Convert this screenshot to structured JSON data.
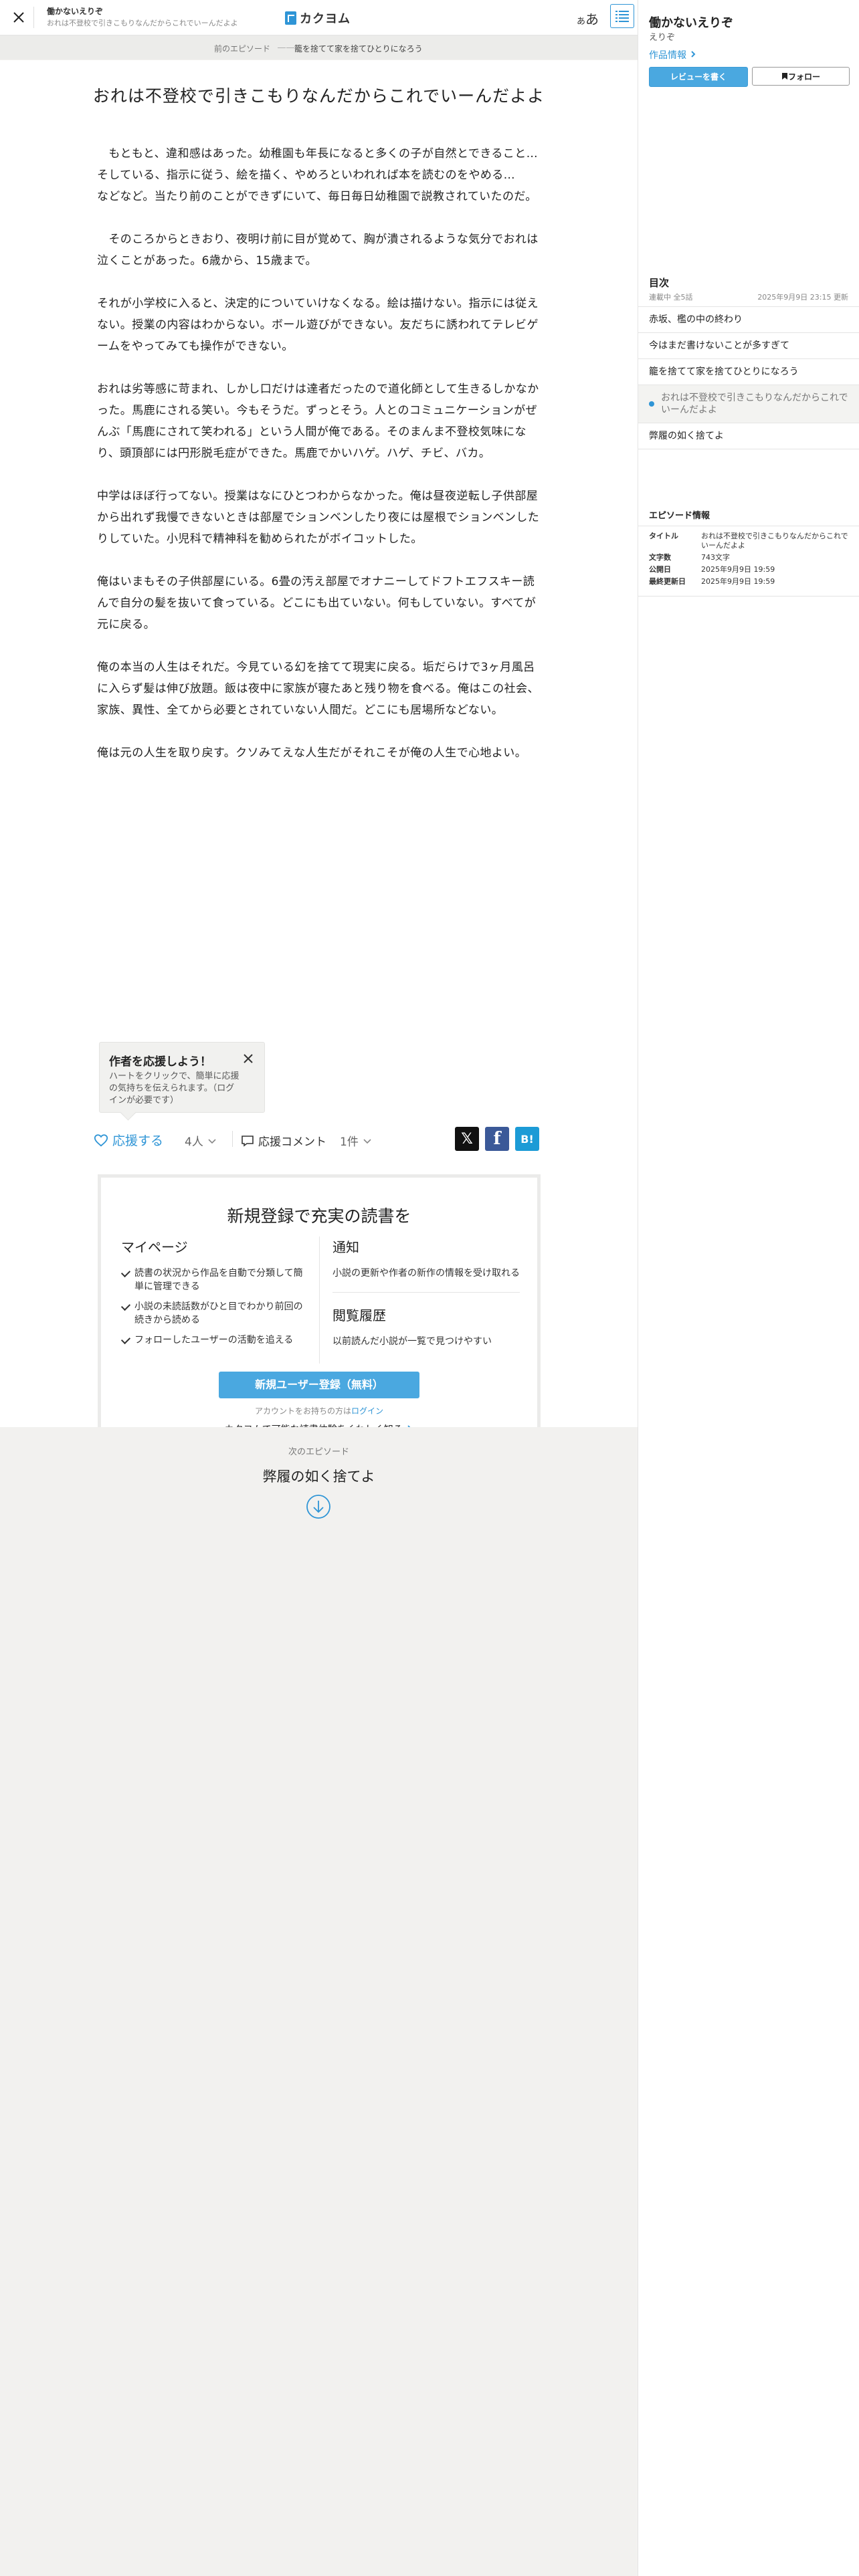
{
  "header": {
    "work_title": "働かないえりぞ",
    "episode_title": "おれは不登校で引きこもりなんだからこれでいーんだよよ",
    "logo_text": "カクヨム",
    "aa_small": "あ",
    "aa_large": "あ"
  },
  "prev_nav": {
    "label": "前のエピソード",
    "dots": "――",
    "title": "籠を捨てて家を捨てひとりになろう"
  },
  "episode": {
    "title": "おれは不登校で引きこもりなんだからこれでいーんだよよ",
    "paragraphs": [
      "　もともと、違和感はあった。幼稚園も年長になると多くの子が自然とできること…\nそしている、指示に従う、絵を描く、やめろといわれれば本を読むのをやめる…\nなどなど。当たり前のことができずにいて、毎日毎日幼稚園で説教されていたのだ。",
      "　そのころからときおり、夜明け前に目が覚めて、胸が潰されるような気分でおれは\n泣くことがあった。6歳から、15歳まで。",
      "それが小学校に入ると、決定的についていけなくなる。絵は描けない。指示には従え\nない。授業の内容はわからない。ボール遊びができない。友だちに誘われてテレビゲ\nームをやってみても操作ができない。",
      "おれは劣等感に苛まれ、しかし口だけは達者だったので道化師として生きるしかなか\nった。馬鹿にされる笑い。今もそうだ。ずっとそう。人とのコミュニケーションがぜ\nんぶ「馬鹿にされて笑われる」という人間が俺である。そのまんま不登校気味にな\nり、頭頂部には円形脱毛症ができた。馬鹿でかいハゲ。ハゲ、チビ、バカ。",
      "中学はほぼ行ってない。授業はなにひとつわからなかった。俺は昼夜逆転し子供部屋\nから出れず我慢できないときは部屋でションベンしたり夜には屋根でションベンした\nりしていた。小児科で精神科を勧められたがボイコットした。",
      "俺はいまもその子供部屋にいる。6畳の汚え部屋でオナニーしてドフトエフスキー読\nんで自分の髪を抜いて食っている。どこにも出ていない。何もしていない。すべてが\n元に戻る。",
      "俺の本当の人生はそれだ。今見ている幻を捨てて現実に戻る。垢だらけで3ヶ月風呂\nに入らず髪は伸び放題。飯は夜中に家族が寝たあと残り物を食べる。俺はこの社会、\n家族、異性、全てから必要とされていない人間だ。どこにも居場所などない。",
      "俺は元の人生を取り戻す。クソみてえな人生だがそれこそが俺の人生で心地よい。"
    ]
  },
  "tooltip": {
    "title": "作者を応援しよう！",
    "body": "ハートをクリックで、簡単に応援の気持ちを伝えられます。（ログインが必要です）"
  },
  "actions": {
    "cheer_label": "応援する",
    "cheer_count": "4人",
    "comment_label": "応援コメント",
    "comment_count": "1件",
    "share_x": "𝕏",
    "share_fb": "f",
    "share_hb": "B!"
  },
  "register": {
    "title": "新規登録で充実の読書を",
    "mypage_heading": "マイページ",
    "mypage_items": [
      "読書の状況から作品を自動で分類して簡単に管理できる",
      "小説の未読話数がひと目でわかり前回の続きから読める",
      "フォローしたユーザーの活動を追える"
    ],
    "notify_heading": "通知",
    "notify_text": "小説の更新や作者の新作の情報を受け取れる",
    "history_heading": "閲覧履歴",
    "history_text": "以前読んだ小説が一覧で見つけやすい",
    "button_label": "新規ユーザー登録（無料）",
    "login_prefix": "アカウントをお持ちの方は",
    "login_link": "ログイン",
    "more_label": "カクヨムで可能な読書体験をくわしく知る"
  },
  "next_episode": {
    "label": "次のエピソード",
    "title": "弊履の如く捨てよ"
  },
  "sidebar": {
    "work_title": "働かないえりぞ",
    "author": "えりぞ",
    "info_link": "作品情報",
    "review_button": "レビューを書く",
    "follow_button": "フォロー",
    "toc_heading": "目次",
    "toc_status": "連載中 全5話",
    "toc_updated": "2025年9月9日 23:15 更新",
    "toc_items": [
      "赤坂、檻の中の終わり",
      "今はまだ書けないことが多すぎて",
      "籠を捨てて家を捨てひとりになろう",
      "おれは不登校で引きこもりなんだからこれでいーんだよよ",
      "弊履の如く捨てよ"
    ],
    "current_index": 3,
    "epinfo_heading": "エピソード情報",
    "epinfo": {
      "title_key": "タイトル",
      "title_val": "おれは不登校で引きこもりなんだからこれでいーんだよよ",
      "chars_key": "文字数",
      "chars_val": "743文字",
      "published_key": "公開日",
      "published_val": "2025年9月9日 19:59",
      "updated_key": "最終更新日",
      "updated_val": "2025年9月9日 19:59"
    }
  },
  "colors": {
    "accent": "#2f95d6",
    "button_blue": "#4aa8e0",
    "page_bg": "#f2f1ef"
  }
}
